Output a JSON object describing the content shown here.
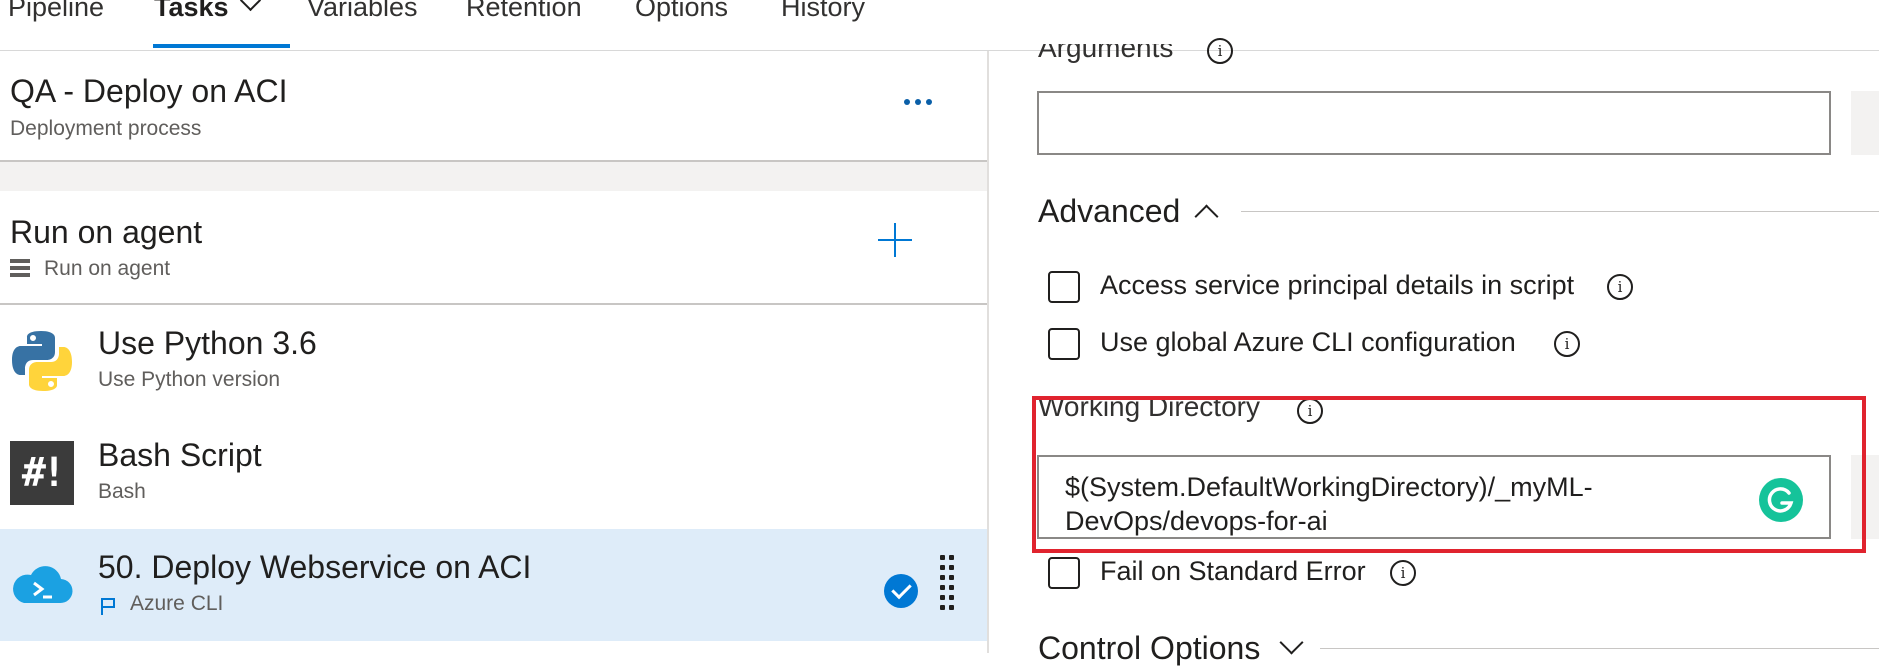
{
  "tabs": [
    {
      "label": "Pipeline"
    },
    {
      "label": "Tasks"
    },
    {
      "label": "Variables"
    },
    {
      "label": "Retention"
    },
    {
      "label": "Options"
    },
    {
      "label": "History"
    }
  ],
  "process": {
    "title": "QA - Deploy on ACI",
    "subtitle": "Deployment process"
  },
  "agent": {
    "title": "Run on agent",
    "subtitle": "Run on agent"
  },
  "tasks": [
    {
      "title": "Use Python 3.6",
      "subtitle": "Use Python version",
      "icon": "python-icon"
    },
    {
      "title": "Bash Script",
      "subtitle": "Bash",
      "icon": "bash-icon",
      "icon_text": "#!"
    },
    {
      "title": "50. Deploy Webservice on ACI",
      "subtitle": "Azure CLI",
      "icon": "azure-cli-icon",
      "selected": true
    }
  ],
  "settings": {
    "arguments_label": "Arguments",
    "arguments_value": "",
    "advanced_title": "Advanced",
    "checkboxes": [
      {
        "label": "Access service principal details in script",
        "checked": false
      },
      {
        "label": "Use global Azure CLI configuration",
        "checked": false
      }
    ],
    "working_directory_label": "Working Directory",
    "working_directory_value": "$(System.DefaultWorkingDirectory)/_myML-DevOps/devops-for-ai",
    "fail_on_stderr_label": "Fail on Standard Error",
    "fail_on_stderr_checked": false,
    "control_options_title": "Control Options"
  },
  "colors": {
    "accent": "#0078d4",
    "selected_row": "#deecf9",
    "highlight_box": "#e0232e",
    "grammarly": "#15c39a"
  }
}
